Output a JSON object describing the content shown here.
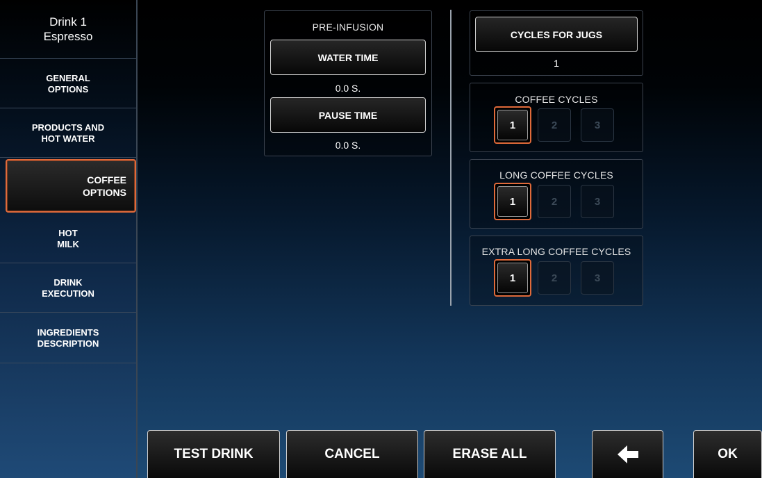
{
  "sidebar": {
    "drink_number": "Drink 1",
    "drink_name": "Espresso",
    "items": [
      {
        "line1": "GENERAL",
        "line2": "OPTIONS"
      },
      {
        "line1": "PRODUCTS AND",
        "line2": "HOT WATER"
      },
      {
        "line1": "COFFEE",
        "line2": "OPTIONS"
      },
      {
        "line1": "HOT",
        "line2": "MILK"
      },
      {
        "line1": "DRINK",
        "line2": "EXECUTION"
      },
      {
        "line1": "INGREDIENTS",
        "line2": "DESCRIPTION"
      }
    ]
  },
  "preinfusion": {
    "title": "PRE-INFUSION",
    "water_time_label": "WATER TIME",
    "water_time_value": "0.0 S.",
    "pause_time_label": "PAUSE TIME",
    "pause_time_value": "0.0 S."
  },
  "jugs": {
    "label": "CYCLES FOR JUGS",
    "value": "1"
  },
  "coffee_cycles": {
    "title": "COFFEE CYCLES",
    "options": [
      "1",
      "2",
      "3"
    ],
    "selected": "1"
  },
  "long_coffee_cycles": {
    "title": "LONG COFFEE CYCLES",
    "options": [
      "1",
      "2",
      "3"
    ],
    "selected": "1"
  },
  "extra_long_coffee_cycles": {
    "title": "EXTRA LONG COFFEE CYCLES",
    "options": [
      "1",
      "2",
      "3"
    ],
    "selected": "1"
  },
  "footer": {
    "test_drink": "TEST DRINK",
    "cancel": "CANCEL",
    "erase_all": "ERASE ALL",
    "back_icon": "arrow-left-icon",
    "ok": "OK"
  },
  "colors": {
    "accent": "#e06a3a"
  }
}
